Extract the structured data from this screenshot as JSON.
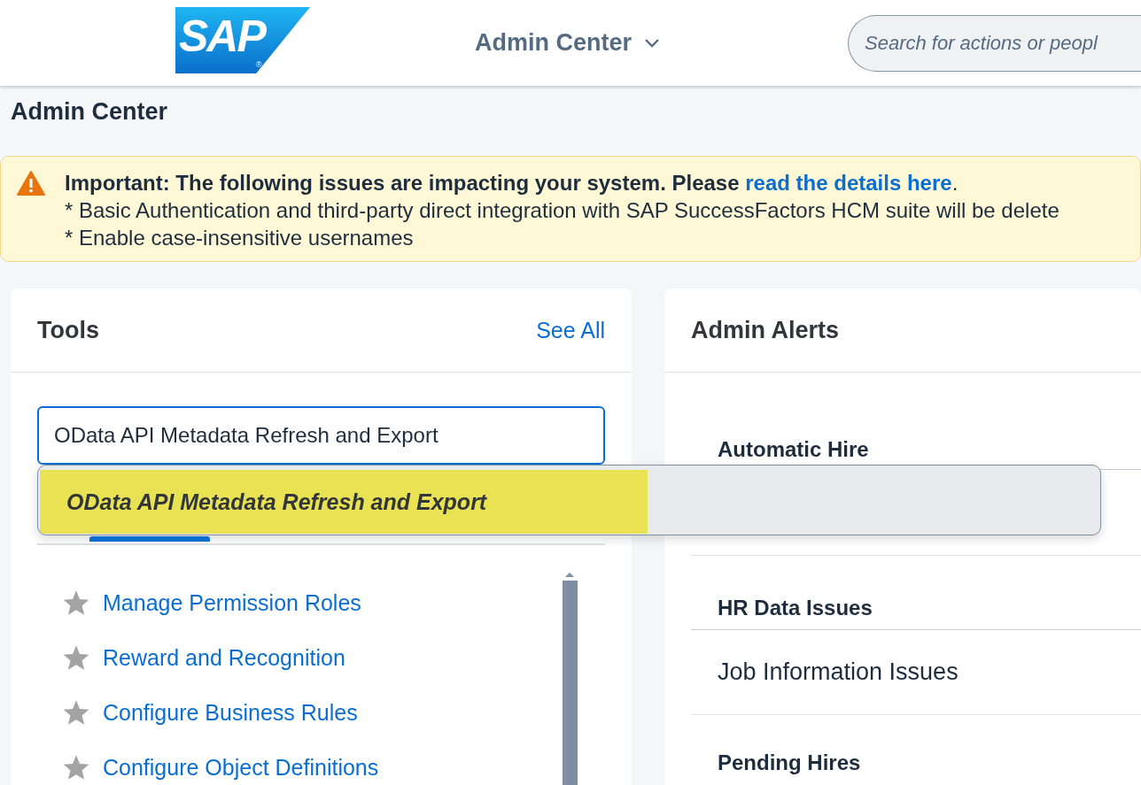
{
  "header": {
    "logo": "SAP",
    "logo_mark": "®",
    "module": "Admin Center",
    "search": {
      "placeholder": "Search for actions or peopl"
    }
  },
  "page_title": "Admin Center",
  "banner": {
    "lead": "**Important: The following issues are impacting your system. Please**",
    "link": "read the details here",
    "end": ".",
    "lines": [
      "* Basic Authentication and third-party direct integration with SAP SuccessFactors HCM suite will be delete",
      "* Enable case-insensitive usernames"
    ]
  },
  "tools": {
    "title": "Tools",
    "see_all": "See All",
    "search_value": "OData API Metadata Refresh and Export",
    "suggestions": [
      {
        "label": "OData API Metadata Refresh and Export",
        "selected": true
      }
    ],
    "items": [
      {
        "label": "Manage Permission Roles",
        "favorite": false
      },
      {
        "label": "Reward and Recognition",
        "favorite": false
      },
      {
        "label": "Configure Business Rules",
        "favorite": false
      },
      {
        "label": "Configure Object Definitions",
        "favorite": false
      }
    ]
  },
  "admin_alerts": {
    "title": "Admin Alerts",
    "items": [
      {
        "kind": "heading",
        "label": "Automatic Hire"
      },
      {
        "kind": "gap"
      },
      {
        "kind": "heading",
        "label": "HR Data Issues"
      },
      {
        "kind": "entry",
        "label": "Job Information Issues"
      },
      {
        "kind": "heading",
        "label": "Pending Hires"
      }
    ]
  }
}
